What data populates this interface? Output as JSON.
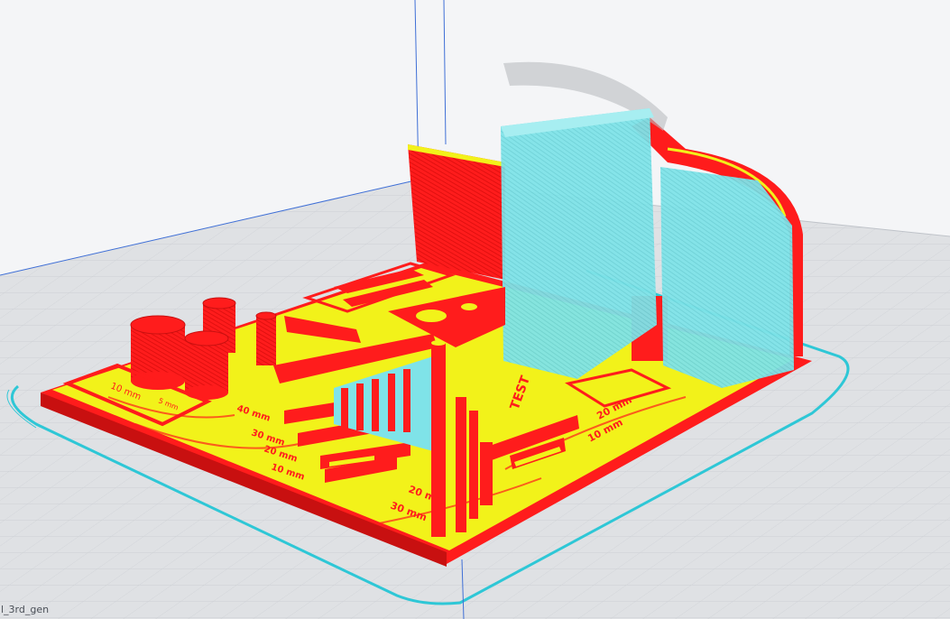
{
  "window": {
    "background": "#f4f5f7"
  },
  "viewport": {
    "file_name": "l_3rd_gen",
    "axis_color": "#3f6fd6",
    "boundary_color": "#2ec7d6",
    "grid_color": "#c9ccd1",
    "bed_color": "#dfe1e4"
  },
  "model": {
    "colors": {
      "wall": "#ff1c1c",
      "infill": "#f2f21a",
      "support": "#7fe3e8",
      "dark_edge": "#b80c0c"
    },
    "labels": {
      "mm_10": "10 mm",
      "mm_20": "20 mm",
      "mm_30": "30 mm",
      "mm_40": "40 mm",
      "angle_10": "10 mm",
      "angle_20": "20 mm",
      "angle_30": "30 mm",
      "calib_title": "TEST",
      "left_box": "10 mm",
      "small_mark": "5 mm"
    }
  }
}
